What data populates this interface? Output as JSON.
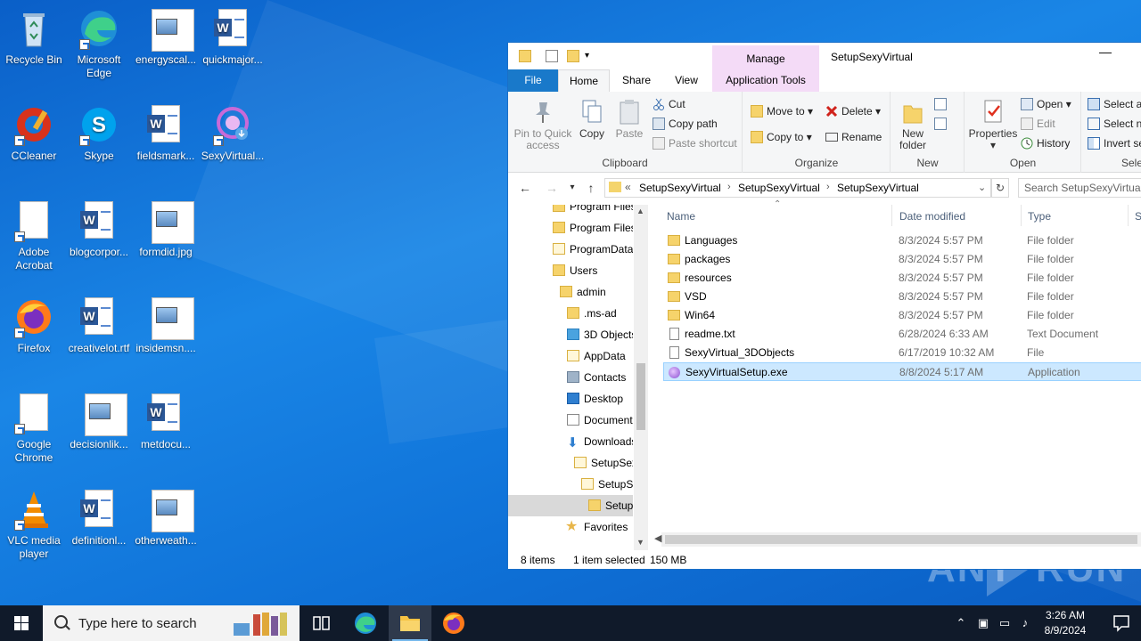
{
  "desktop": {
    "icons": [
      {
        "label": "Recycle Bin"
      },
      {
        "label": "Microsoft Edge"
      },
      {
        "label": "energyscal..."
      },
      {
        "label": "quickmajor..."
      },
      {
        "label": "CCleaner"
      },
      {
        "label": "Skype"
      },
      {
        "label": "fieldsmark..."
      },
      {
        "label": "SexyVirtual..."
      },
      {
        "label": "Adobe Acrobat"
      },
      {
        "label": "blogcorpor..."
      },
      {
        "label": "formdid.jpg"
      },
      {
        "label": "Firefox"
      },
      {
        "label": "creativelot.rtf"
      },
      {
        "label": "insidemsn...."
      },
      {
        "label": "Google Chrome"
      },
      {
        "label": "decisionlik..."
      },
      {
        "label": "metdocu..."
      },
      {
        "label": "VLC media player"
      },
      {
        "label": "definitionl..."
      },
      {
        "label": "otherweath..."
      }
    ]
  },
  "explorer": {
    "title": "SetupSexyVirtual",
    "minimize": "—",
    "manage_tab": "Manage",
    "tabs": {
      "file": "File",
      "home": "Home",
      "share": "Share",
      "view": "View",
      "app_tools": "Application Tools"
    },
    "ribbon": {
      "clipboard": {
        "label": "Clipboard",
        "pin": "Pin to Quick access",
        "copy": "Copy",
        "paste": "Paste",
        "cut": "Cut",
        "copy_path": "Copy path",
        "paste_shortcut": "Paste shortcut"
      },
      "organize": {
        "label": "Organize",
        "move_to": "Move to",
        "copy_to": "Copy to",
        "delete": "Delete",
        "rename": "Rename"
      },
      "new": {
        "label": "New",
        "new_folder": "New folder"
      },
      "open": {
        "label": "Open",
        "properties": "Properties",
        "open": "Open",
        "edit": "Edit",
        "history": "History"
      },
      "select": {
        "label": "Sele",
        "select_all": "Select a",
        "select_none": "Select n",
        "invert": "Invert se"
      }
    },
    "address": {
      "overflow": "«",
      "crumbs": [
        "SetupSexyVirtual",
        "SetupSexyVirtual",
        "SetupSexyVirtual"
      ],
      "search_placeholder": "Search SetupSexyVirtual"
    },
    "nav": [
      {
        "label": "Program Files"
      },
      {
        "label": "Program Files"
      },
      {
        "label": "ProgramData"
      },
      {
        "label": "Users"
      },
      {
        "label": "admin"
      },
      {
        "label": ".ms-ad"
      },
      {
        "label": "3D Objects"
      },
      {
        "label": "AppData"
      },
      {
        "label": "Contacts"
      },
      {
        "label": "Desktop"
      },
      {
        "label": "Documents"
      },
      {
        "label": "Downloads"
      },
      {
        "label": "SetupSexyVirtual"
      },
      {
        "label": "SetupSexyVirtual"
      },
      {
        "label": "SetupSexyVirtual"
      },
      {
        "label": "Favorites"
      }
    ],
    "columns": {
      "name": "Name",
      "date": "Date modified",
      "type": "Type",
      "size": "Si"
    },
    "files": [
      {
        "name": "Languages",
        "date": "8/3/2024 5:57 PM",
        "type": "File folder",
        "kind": "folder"
      },
      {
        "name": "packages",
        "date": "8/3/2024 5:57 PM",
        "type": "File folder",
        "kind": "folder"
      },
      {
        "name": "resources",
        "date": "8/3/2024 5:57 PM",
        "type": "File folder",
        "kind": "folder"
      },
      {
        "name": "VSD",
        "date": "8/3/2024 5:57 PM",
        "type": "File folder",
        "kind": "folder"
      },
      {
        "name": "Win64",
        "date": "8/3/2024 5:57 PM",
        "type": "File folder",
        "kind": "folder"
      },
      {
        "name": "readme.txt",
        "date": "6/28/2024 6:33 AM",
        "type": "Text Document",
        "kind": "file"
      },
      {
        "name": "SexyVirtual_3DObjects",
        "date": "6/17/2019 10:32 AM",
        "type": "File",
        "kind": "file"
      },
      {
        "name": "SexyVirtualSetup.exe",
        "date": "8/8/2024 5:17 AM",
        "type": "Application",
        "kind": "exe",
        "selected": true
      }
    ],
    "status": {
      "items": "8 items",
      "selected": "1 item selected",
      "size": "150 MB"
    }
  },
  "taskbar": {
    "search_placeholder": "Type here to search",
    "time": "3:26 AM",
    "date": "8/9/2024"
  },
  "watermark": {
    "left": "ANY",
    "right": "RUN"
  },
  "colors": {
    "accent": "#1979ca",
    "manage_tab": "#f4dbf7",
    "selection": "#cce8ff",
    "taskbar": "#101a2a"
  }
}
